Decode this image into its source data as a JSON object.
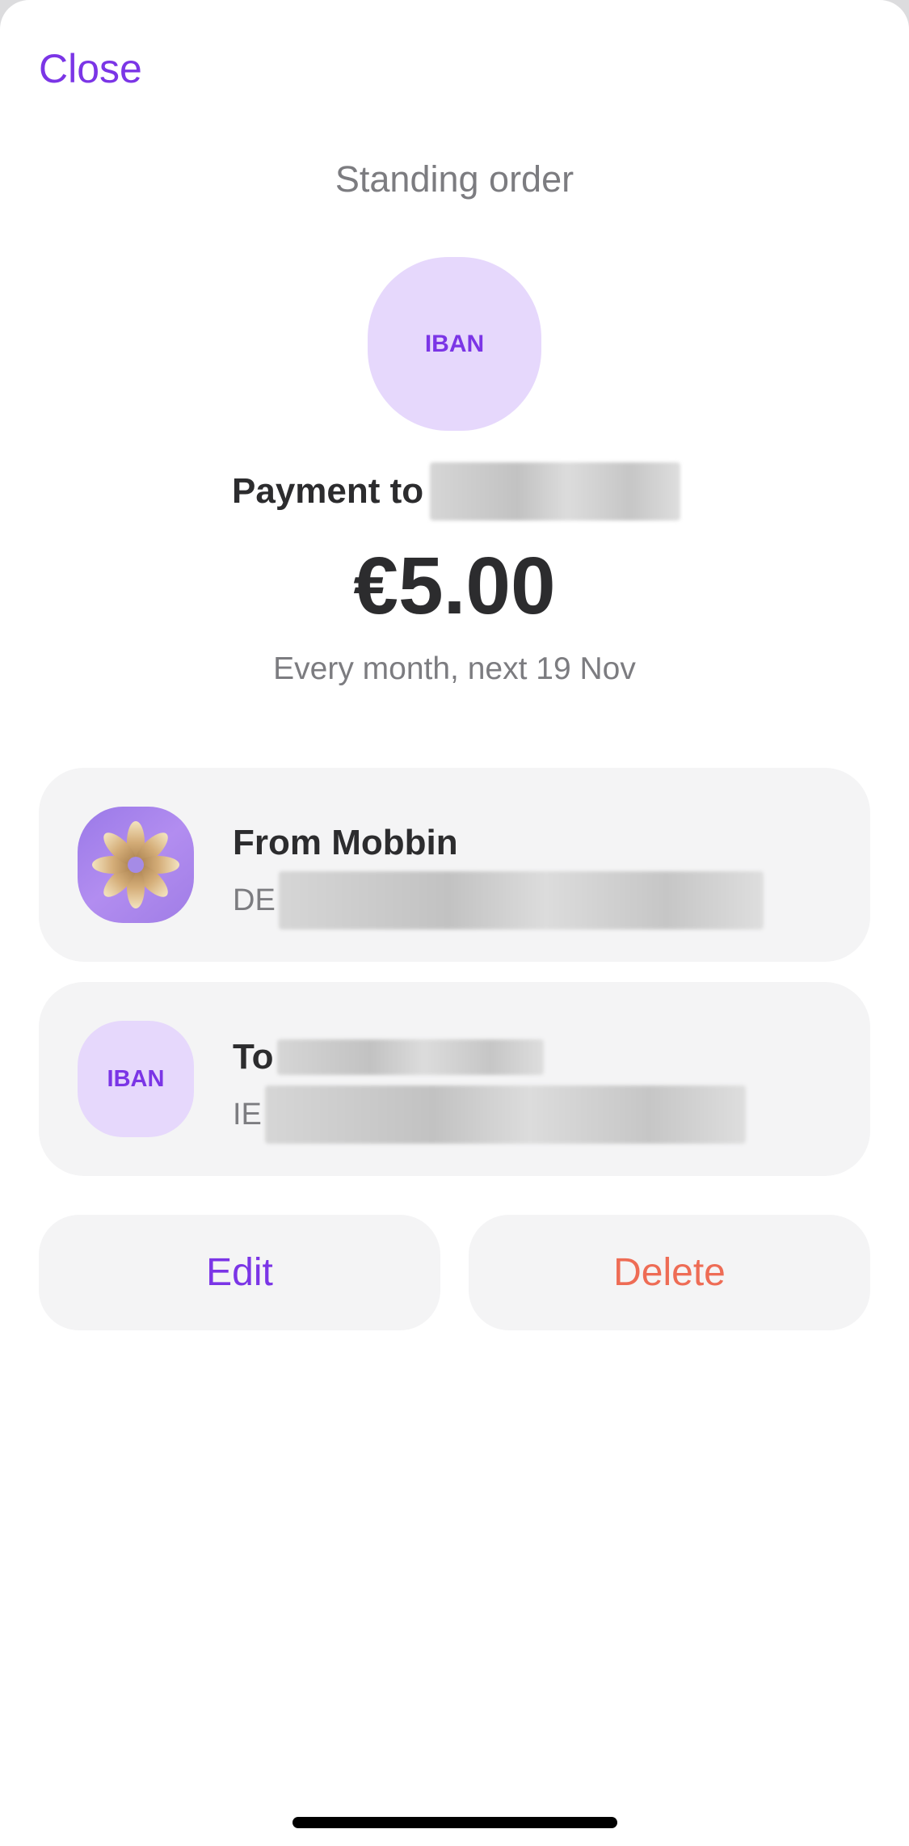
{
  "header": {
    "close_label": "Close",
    "title": "Standing order"
  },
  "recipient_avatar": {
    "label": "IBAN",
    "icon": "iban-icon"
  },
  "payment": {
    "title_prefix": "Payment to",
    "amount": "€5.00",
    "schedule": "Every month, next 19 Nov"
  },
  "from_account": {
    "name": "From Mobbin",
    "iban_prefix": "DE",
    "icon": "mobbin-flower-icon"
  },
  "to_account": {
    "name_prefix": "To",
    "iban_prefix": "IE",
    "avatar_label": "IBAN",
    "icon": "iban-icon"
  },
  "actions": {
    "edit_label": "Edit",
    "delete_label": "Delete"
  },
  "colors": {
    "accent": "#7b35e6",
    "danger": "#ee6c55",
    "avatar_bg": "#e6d8fc",
    "card_bg": "#f4f4f5",
    "text_primary": "#2c2c2e",
    "text_secondary": "#7c7c80"
  }
}
